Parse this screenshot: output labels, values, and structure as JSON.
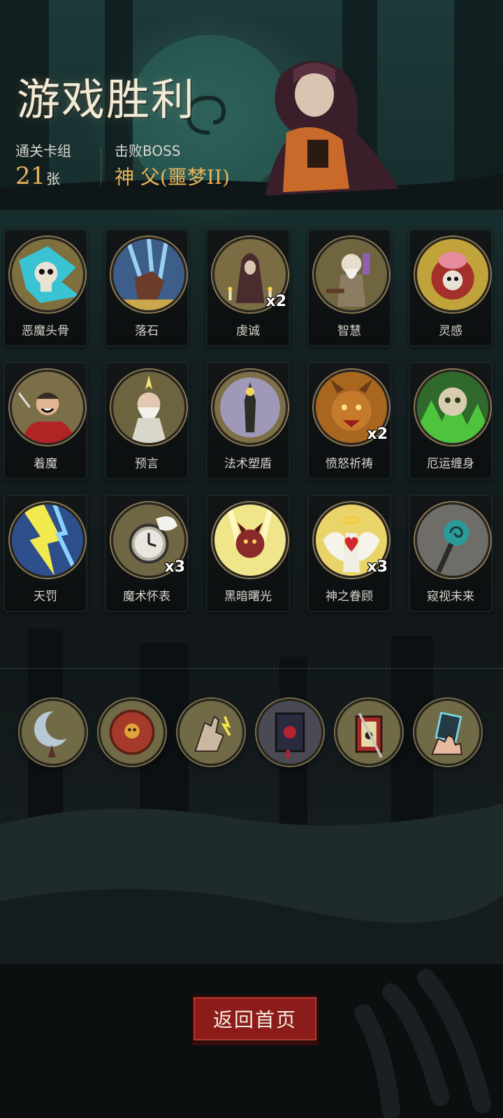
{
  "header": {
    "title": "游戏胜利",
    "deck_label": "通关卡组",
    "deck_count": "21",
    "deck_unit": "张",
    "boss_label": "击败BOSS",
    "boss_name": "神 父(噩梦II)"
  },
  "cards": [
    {
      "name": "恶魔头骨",
      "count": "",
      "art": "skull-blue"
    },
    {
      "name": "落石",
      "count": "",
      "art": "falling-rock"
    },
    {
      "name": "虔诚",
      "count": "x2",
      "art": "hooded-monk"
    },
    {
      "name": "智慧",
      "count": "",
      "art": "old-scholar"
    },
    {
      "name": "灵感",
      "count": "",
      "art": "brain-skull"
    },
    {
      "name": "着魔",
      "count": "",
      "art": "possessed-man"
    },
    {
      "name": "预言",
      "count": "",
      "art": "prophet"
    },
    {
      "name": "法术塑盾",
      "count": "",
      "art": "spell-shield"
    },
    {
      "name": "愤怒祈祷",
      "count": "x2",
      "art": "angry-beast"
    },
    {
      "name": "厄运缠身",
      "count": "",
      "art": "green-skull"
    },
    {
      "name": "天罚",
      "count": "",
      "art": "lightning"
    },
    {
      "name": "魔术怀表",
      "count": "x3",
      "art": "pocket-watch"
    },
    {
      "name": "黑暗曙光",
      "count": "",
      "art": "dark-demon"
    },
    {
      "name": "神之眷顾",
      "count": "x3",
      "art": "angel-heart"
    },
    {
      "name": "窥视未来",
      "count": "",
      "art": "staff-orb"
    }
  ],
  "relics": [
    {
      "icon": "moon-relic-icon"
    },
    {
      "icon": "shield-skull-relic-icon"
    },
    {
      "icon": "snap-hand-relic-icon"
    },
    {
      "icon": "red-book-relic-icon"
    },
    {
      "icon": "tarot-card-relic-icon"
    },
    {
      "icon": "magic-hand-relic-icon"
    }
  ],
  "buttons": {
    "return_home": "返回首页"
  }
}
